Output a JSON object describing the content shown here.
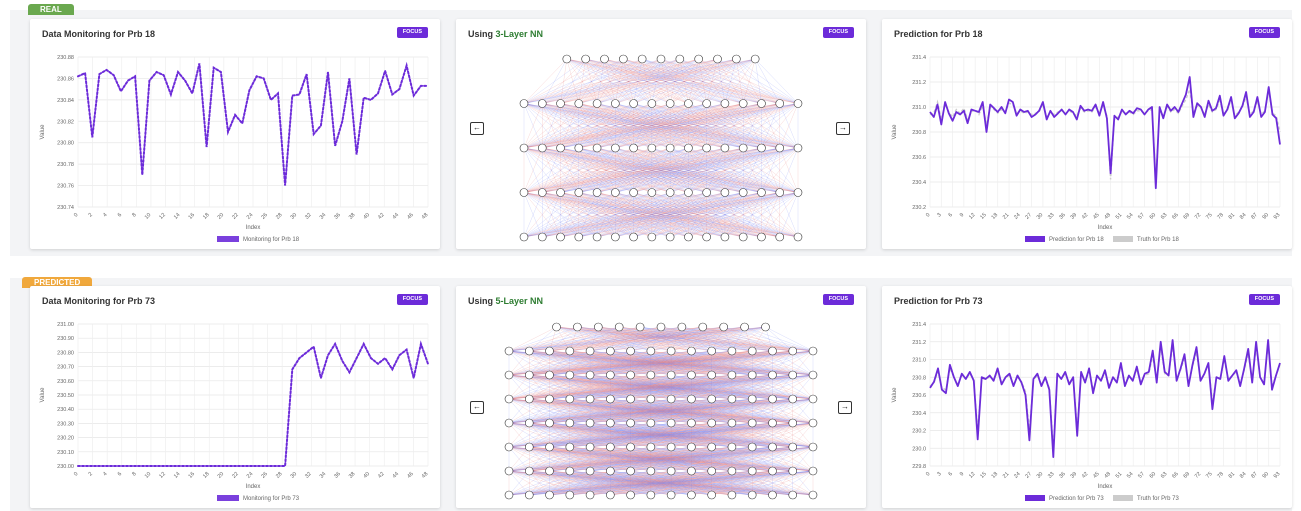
{
  "rows": [
    {
      "badge": "REAL",
      "monitor": {
        "title": "Data Monitoring for Prb 18",
        "focus": "FOCUS",
        "ylabel": "Value",
        "xlabel": "Index",
        "legend": "Monitoring for Prb 18"
      },
      "nn": {
        "prefix": "Using ",
        "highlight": "3-Layer NN",
        "focus": "FOCUS"
      },
      "prediction": {
        "title": "Prediction for Prb 18",
        "focus": "FOCUS",
        "ylabel": "Value",
        "xlabel": "Index",
        "legend_pred": "Prediction for Prb 18",
        "legend_truth": "Truth for Prb 18"
      }
    },
    {
      "badge": "PREDICTED",
      "monitor": {
        "title": "Data Monitoring for Prb 73",
        "focus": "FOCUS",
        "ylabel": "Value",
        "xlabel": "Index",
        "legend": "Monitoring for Prb 73"
      },
      "nn": {
        "prefix": "Using ",
        "highlight": "5-Layer NN",
        "focus": "FOCUS"
      },
      "prediction": {
        "title": "Prediction for Prb 73",
        "focus": "FOCUS",
        "ylabel": "Value",
        "xlabel": "Index",
        "legend_pred": "Prediction for Prb 73",
        "legend_truth": "Truth for Prb 73"
      }
    }
  ],
  "icons": {
    "prev": "arrow-left-icon",
    "next": "arrow-right-icon"
  },
  "colors": {
    "accent": "#6c2bd9",
    "real_badge": "#6aa84f",
    "pred_badge": "#f0a83c",
    "nn_title": "#2e7d32",
    "truth": "#cccccc"
  },
  "nn_layers": {
    "nn3": [
      11,
      16,
      16,
      16,
      16
    ],
    "nn5": [
      11,
      16,
      16,
      16,
      16,
      16,
      16,
      16
    ]
  },
  "chart_data": [
    {
      "type": "line",
      "title": "Data Monitoring for Prb 18",
      "xlabel": "Index",
      "ylabel": "Value",
      "ylim": [
        230.74,
        230.88
      ],
      "yticks": [
        "230.74",
        "230.76",
        "230.78",
        "230.80",
        "230.82",
        "230.84",
        "230.86",
        "230.88"
      ],
      "xticks": [
        "0",
        "2",
        "4",
        "6",
        "8",
        "10",
        "12",
        "14",
        "16",
        "18",
        "20",
        "22",
        "24",
        "26",
        "28",
        "30",
        "32",
        "34",
        "36",
        "38",
        "40",
        "42",
        "44",
        "46",
        "48"
      ],
      "series": [
        {
          "name": "Monitoring for Prb 18",
          "style": "dotted",
          "values": [
            230.862,
            230.865,
            230.805,
            230.864,
            230.868,
            230.863,
            230.848,
            230.858,
            230.862,
            230.77,
            230.858,
            230.866,
            230.863,
            230.845,
            230.866,
            230.858,
            230.846,
            230.874,
            230.796,
            230.87,
            230.866,
            230.81,
            230.826,
            230.818,
            230.849,
            230.862,
            230.86,
            230.84,
            230.846,
            230.76,
            230.844,
            230.845,
            230.864,
            230.808,
            230.816,
            230.866,
            230.797,
            230.82,
            230.86,
            230.789,
            230.842,
            230.84,
            230.846,
            230.867,
            230.845,
            230.85,
            230.872,
            230.844,
            230.853,
            230.853
          ]
        }
      ]
    },
    {
      "type": "line",
      "title": "Prediction for Prb 18",
      "xlabel": "Index",
      "ylabel": "Value",
      "ylim": [
        230.2,
        231.4
      ],
      "yticks": [
        "230.2",
        "230.4",
        "230.6",
        "230.8",
        "231.0",
        "231.2",
        "231.4"
      ],
      "xticks": [
        "0",
        "3",
        "6",
        "9",
        "12",
        "15",
        "18",
        "21",
        "24",
        "27",
        "30",
        "33",
        "36",
        "39",
        "42",
        "45",
        "48",
        "51",
        "54",
        "57",
        "60",
        "63",
        "66",
        "69",
        "72",
        "75",
        "78",
        "81",
        "84",
        "87",
        "90",
        "93"
      ],
      "series": [
        {
          "name": "Prediction for Prb 18",
          "values": [
            230.96,
            230.92,
            231.02,
            230.86,
            231.04,
            230.95,
            230.89,
            230.96,
            230.94,
            230.97,
            230.87,
            230.98,
            230.97,
            230.96,
            231.04,
            230.8,
            231.02,
            230.99,
            230.96,
            231.0,
            230.95,
            231.06,
            231.04,
            230.93,
            230.98,
            230.96,
            230.97,
            230.92,
            230.94,
            230.97,
            231.04,
            230.9,
            230.97,
            230.92,
            230.95,
            230.98,
            230.94,
            230.98,
            230.96,
            230.9,
            231.01,
            230.97,
            230.98,
            230.97,
            231.02,
            230.93,
            231.04,
            230.91,
            230.47,
            230.93,
            230.9,
            230.98,
            230.94,
            230.97,
            230.95,
            230.99,
            230.98,
            230.94,
            230.98,
            231.0,
            230.35,
            231.0,
            230.91,
            231.02,
            230.97,
            231.0,
            230.96,
            231.03,
            231.1,
            231.24,
            230.92,
            231.03,
            231.0,
            230.92,
            231.05,
            230.97,
            230.99,
            231.09,
            230.93,
            230.98,
            231.08,
            230.91,
            230.95,
            231.01,
            231.12,
            230.92,
            230.96,
            231.08,
            230.92,
            230.96,
            231.16,
            230.94,
            230.91,
            230.7
          ]
        },
        {
          "name": "Truth for Prb 18",
          "values": [
            230.94,
            230.95,
            231.04,
            230.9,
            231.02,
            230.96,
            230.92,
            230.98,
            230.95,
            230.99,
            230.9,
            230.96,
            230.98,
            230.94,
            231.01,
            230.86,
            231.0,
            230.98,
            230.95,
            230.98,
            230.96,
            231.03,
            231.02,
            230.95,
            230.97,
            230.95,
            230.96,
            230.94,
            230.95,
            230.96,
            231.02,
            230.92,
            230.96,
            230.94,
            230.96,
            230.97,
            230.95,
            230.97,
            230.95,
            230.93,
            230.99,
            230.96,
            230.97,
            230.96,
            231.0,
            230.95,
            231.01,
            230.93,
            230.42,
            230.9,
            230.92,
            230.96,
            230.95,
            230.96,
            230.94,
            230.97,
            230.97,
            230.95,
            230.97,
            230.98,
            230.42,
            230.97,
            230.93,
            231.0,
            230.96,
            230.98,
            230.95,
            231.01,
            231.06,
            231.14,
            230.95,
            231.01,
            230.99,
            230.94,
            231.02,
            230.96,
            230.98,
            231.05,
            230.95,
            230.97,
            231.06,
            230.93,
            230.96,
            231.0,
            231.08,
            230.94,
            230.97,
            231.05,
            230.94,
            230.97,
            231.12,
            230.95,
            230.93,
            230.8
          ]
        }
      ]
    },
    {
      "type": "line",
      "title": "Data Monitoring for Prb 73",
      "xlabel": "Index",
      "ylabel": "Value",
      "ylim": [
        230.0,
        231.0
      ],
      "yticks": [
        "230.00",
        "230.10",
        "230.20",
        "230.30",
        "230.40",
        "230.50",
        "230.60",
        "230.70",
        "230.80",
        "230.90",
        "231.00"
      ],
      "xticks": [
        "0",
        "2",
        "4",
        "6",
        "8",
        "10",
        "12",
        "14",
        "16",
        "18",
        "20",
        "22",
        "24",
        "26",
        "28",
        "30",
        "32",
        "34",
        "36",
        "38",
        "40",
        "42",
        "44",
        "46",
        "48"
      ],
      "series": [
        {
          "name": "Monitoring for Prb 73",
          "style": "dotted",
          "values": [
            230,
            230,
            230,
            230,
            230,
            230,
            230,
            230,
            230,
            230,
            230,
            230,
            230,
            230,
            230,
            230,
            230,
            230,
            230,
            230,
            230,
            230,
            230,
            230,
            230,
            230,
            230,
            230,
            230,
            230,
            230.68,
            230.76,
            230.8,
            230.84,
            230.62,
            230.78,
            230.86,
            230.74,
            230.66,
            230.76,
            230.86,
            230.76,
            230.72,
            230.76,
            230.68,
            230.78,
            230.82,
            230.62,
            230.86,
            230.72
          ]
        }
      ]
    },
    {
      "type": "line",
      "title": "Prediction for Prb 73",
      "xlabel": "Index",
      "ylabel": "Value",
      "ylim": [
        229.8,
        231.4
      ],
      "yticks": [
        "229.8",
        "230.0",
        "230.2",
        "230.4",
        "230.6",
        "230.8",
        "231.0",
        "231.2",
        "231.4"
      ],
      "xticks": [
        "0",
        "3",
        "6",
        "9",
        "12",
        "15",
        "18",
        "21",
        "24",
        "27",
        "30",
        "33",
        "36",
        "39",
        "42",
        "45",
        "48",
        "51",
        "54",
        "57",
        "60",
        "63",
        "66",
        "69",
        "72",
        "75",
        "78",
        "81",
        "84",
        "87",
        "90",
        "93"
      ],
      "series": [
        {
          "name": "Prediction for Prb 73",
          "values": [
            230.68,
            230.75,
            230.9,
            230.66,
            230.62,
            230.94,
            230.8,
            230.7,
            230.84,
            230.78,
            230.86,
            230.76,
            230.1,
            230.8,
            230.78,
            230.82,
            230.76,
            230.9,
            230.72,
            230.8,
            230.84,
            230.7,
            230.82,
            230.74,
            230.6,
            230.09,
            230.78,
            230.84,
            230.7,
            230.8,
            230.66,
            229.9,
            230.84,
            230.78,
            230.86,
            230.72,
            230.8,
            230.14,
            230.86,
            230.74,
            230.9,
            230.62,
            230.82,
            230.76,
            230.88,
            230.68,
            230.8,
            230.74,
            230.96,
            230.7,
            230.82,
            230.76,
            230.92,
            230.72,
            230.84,
            230.86,
            231.1,
            230.74,
            231.2,
            230.86,
            230.82,
            231.22,
            230.76,
            230.9,
            231.06,
            230.7,
            230.94,
            231.14,
            230.76,
            230.84,
            230.96,
            230.44,
            230.8,
            230.78,
            231.04,
            230.76,
            230.82,
            230.88,
            230.7,
            230.9,
            231.12,
            230.74,
            231.2,
            230.8,
            230.72,
            231.22,
            230.66,
            230.82,
            230.96
          ]
        },
        {
          "name": "Truth for Prb 73",
          "values": [
            230.7,
            230.74,
            230.86,
            230.68,
            230.66,
            230.9,
            230.8,
            230.72,
            230.82,
            230.78,
            230.84,
            230.77,
            230.2,
            230.78,
            230.78,
            230.8,
            230.77,
            230.86,
            230.74,
            230.8,
            230.82,
            230.72,
            230.8,
            230.75,
            230.64,
            230.2,
            230.77,
            230.82,
            230.72,
            230.8,
            230.68,
            230.0,
            230.82,
            230.78,
            230.84,
            230.74,
            230.8,
            230.22,
            230.84,
            230.75,
            230.86,
            230.66,
            230.8,
            230.77,
            230.85,
            230.7,
            230.8,
            230.75,
            230.92,
            230.72,
            230.8,
            230.77,
            230.88,
            230.74,
            230.82,
            230.84,
            231.04,
            230.76,
            231.14,
            230.84,
            230.82,
            231.16,
            230.78,
            230.88,
            231.02,
            230.72,
            230.92,
            231.08,
            230.78,
            230.84,
            230.94,
            230.52,
            230.8,
            230.78,
            231.0,
            230.78,
            230.82,
            230.86,
            230.72,
            230.88,
            231.06,
            230.76,
            231.14,
            230.8,
            230.74,
            231.16,
            230.7,
            230.82,
            230.94
          ]
        }
      ]
    }
  ]
}
